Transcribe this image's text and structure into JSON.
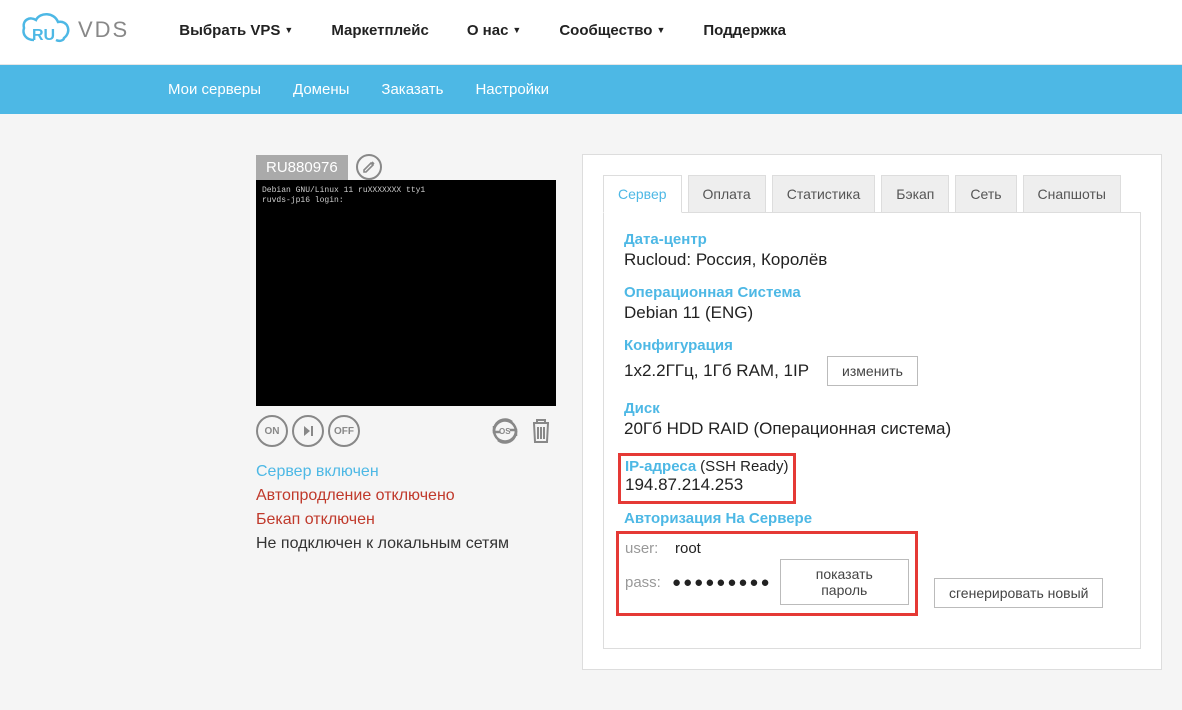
{
  "logo": {
    "ru": "RU",
    "vds": "VDS"
  },
  "topnav": {
    "choose_vps": "Выбрать VPS",
    "marketplace": "Маркетплейс",
    "about": "О нас",
    "community": "Сообщество",
    "support": "Поддержка"
  },
  "bluenav": {
    "my_servers": "Мои серверы",
    "domains": "Домены",
    "order": "Заказать",
    "settings": "Настройки"
  },
  "server": {
    "name": "RU880976",
    "console_lines": [
      "Debian GNU/Linux 11 ruXXXXXXX tty1",
      "ruvds-jp16 login:"
    ],
    "actions": {
      "on": "ON",
      "off": "OFF",
      "os": "OS"
    },
    "status": {
      "on": "Сервер включен",
      "autorenew_off": "Автопродление отключено",
      "backup_off": "Бекап отключен",
      "no_local_net": "Не подключен к локальным сетям"
    }
  },
  "tabs": {
    "server": "Сервер",
    "payment": "Оплата",
    "stats": "Статистика",
    "backup": "Бэкап",
    "network": "Сеть",
    "snapshots": "Снапшоты"
  },
  "details": {
    "datacenter_label": "Дата-центр",
    "datacenter_value": "Rucloud: Россия, Королёв",
    "os_label": "Операционная Система",
    "os_value": "Debian 11 (ENG)",
    "config_label": "Конфигурация",
    "config_value": "1x2.2ГГц, 1Гб RAM, 1IP",
    "change_btn": "изменить",
    "disk_label": "Диск",
    "disk_value": "20Гб HDD RAID (Операционная система)",
    "ip_label": "IP-адреса",
    "ssh_ready": "(SSH Ready)",
    "ip_value": "194.87.214.253",
    "auth_label": "Авторизация На Сервере",
    "user_label": "user:",
    "user_value": "root",
    "pass_label": "pass:",
    "pass_value": "●●●●●●●●●",
    "show_pass_btn": "показать пароль",
    "gen_pass_btn": "сгенерировать новый"
  }
}
